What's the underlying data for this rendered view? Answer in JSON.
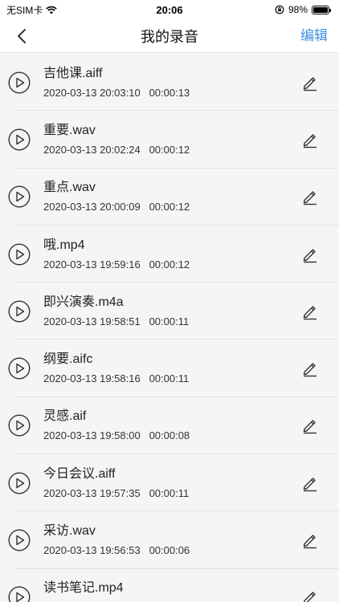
{
  "status_bar": {
    "carrier": "无SIM卡",
    "time": "20:06",
    "battery": "98%",
    "battery_level": 0.98
  },
  "nav": {
    "title": "我的录音",
    "edit_label": "编辑"
  },
  "recordings": [
    {
      "name": "吉他课.aiff",
      "date": "2020-03-13 20:03:10",
      "duration": "00:00:13"
    },
    {
      "name": "重要.wav",
      "date": "2020-03-13 20:02:24",
      "duration": "00:00:12"
    },
    {
      "name": "重点.wav",
      "date": "2020-03-13 20:00:09",
      "duration": "00:00:12"
    },
    {
      "name": "哦.mp4",
      "date": "2020-03-13 19:59:16",
      "duration": "00:00:12"
    },
    {
      "name": "即兴演奏.m4a",
      "date": "2020-03-13 19:58:51",
      "duration": "00:00:11"
    },
    {
      "name": "纲要.aifc",
      "date": "2020-03-13 19:58:16",
      "duration": "00:00:11"
    },
    {
      "name": "灵感.aif",
      "date": "2020-03-13 19:58:00",
      "duration": "00:00:08"
    },
    {
      "name": "今日会议.aiff",
      "date": "2020-03-13 19:57:35",
      "duration": "00:00:11"
    },
    {
      "name": "采访.wav",
      "date": "2020-03-13 19:56:53",
      "duration": "00:00:06"
    },
    {
      "name": "读书笔记.mp4",
      "date": "",
      "duration": ""
    }
  ],
  "icons": {
    "play": "play-circle-icon",
    "edit": "pencil-icon",
    "back": "chevron-left-icon"
  }
}
